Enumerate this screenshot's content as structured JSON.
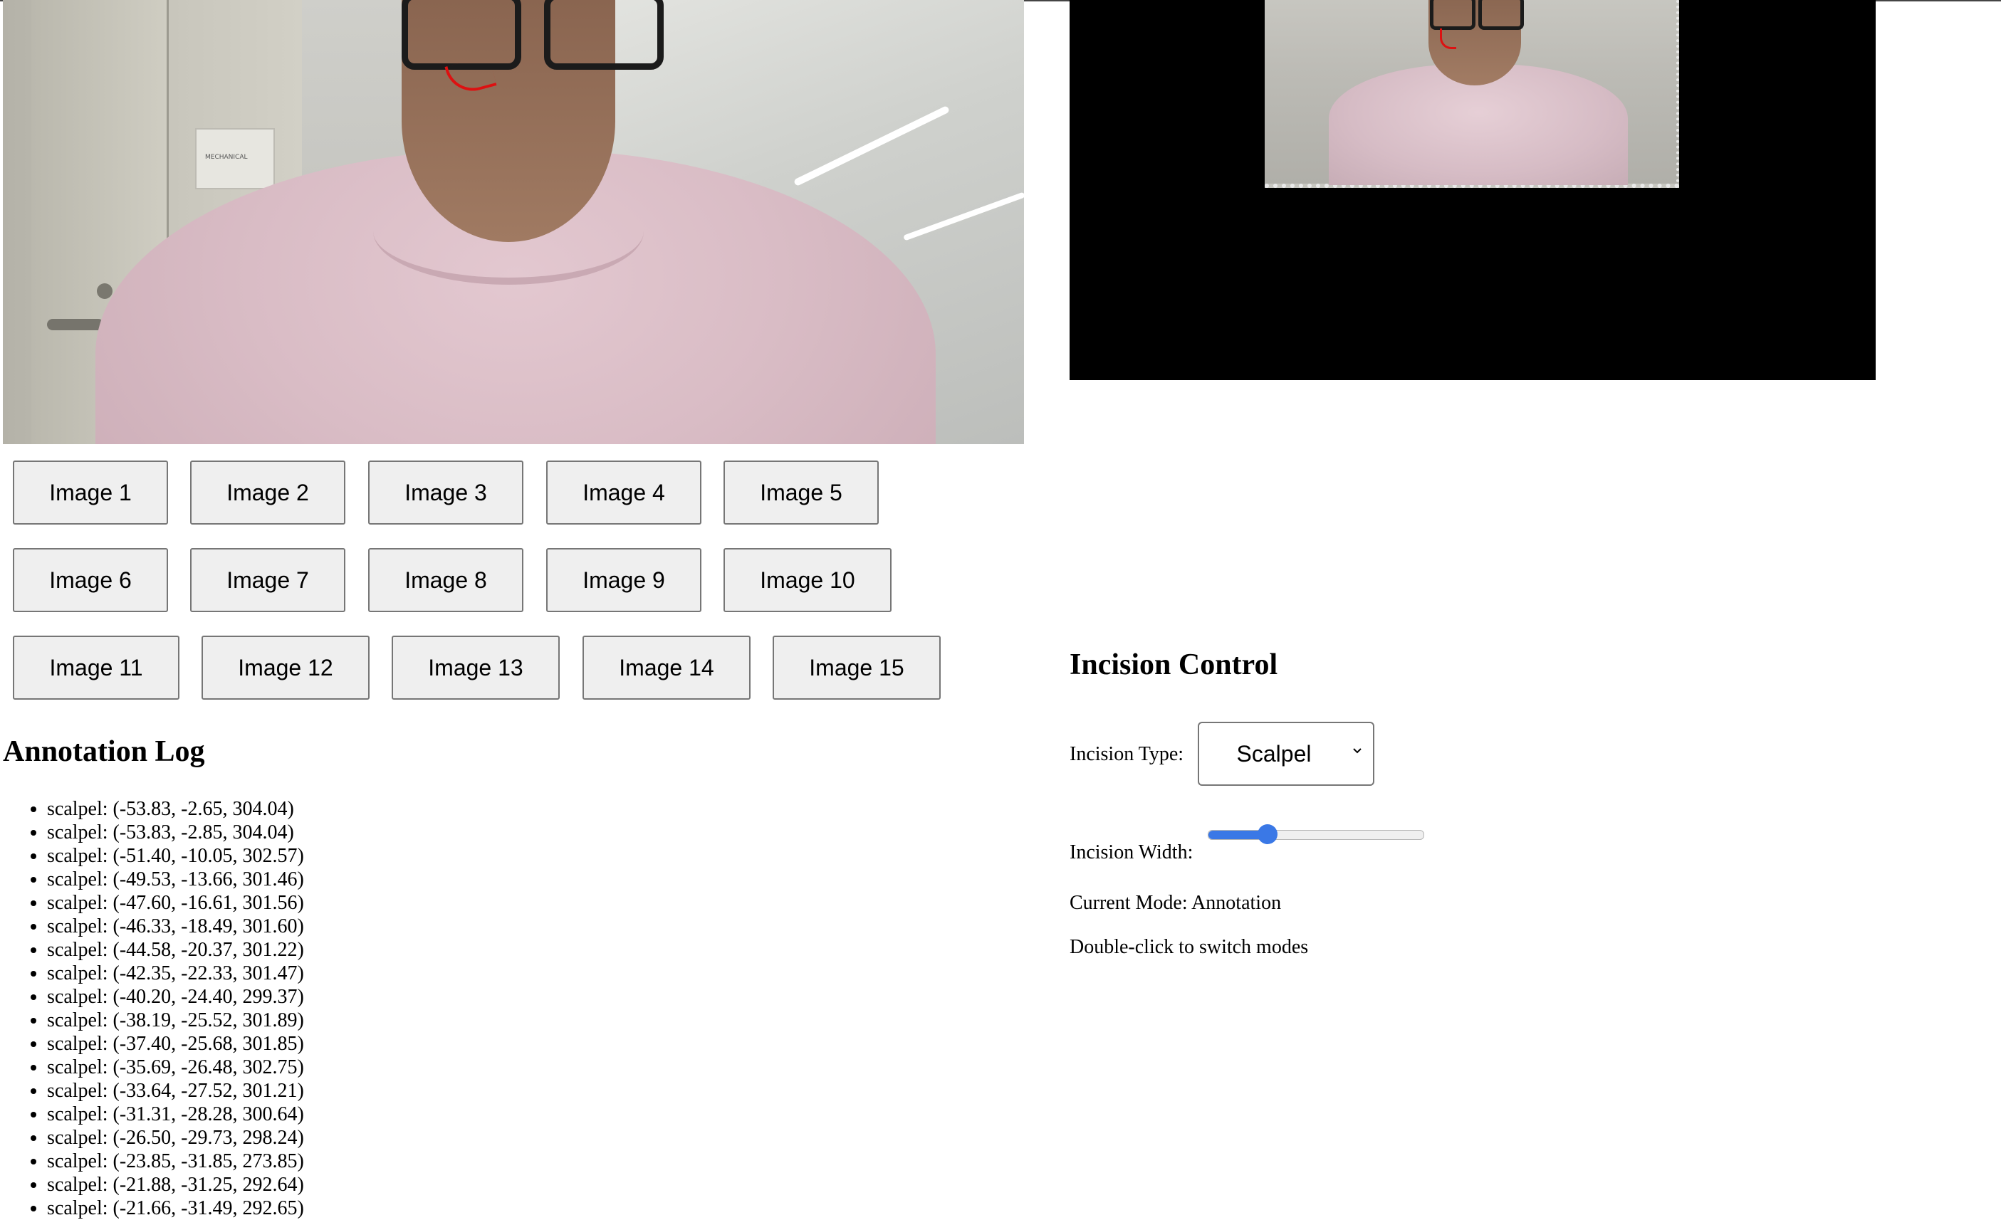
{
  "images": {
    "row1": [
      "Image 1",
      "Image 2",
      "Image 3",
      "Image 4",
      "Image 5"
    ],
    "row2": [
      "Image 6",
      "Image 7",
      "Image 8",
      "Image 9",
      "Image 10"
    ],
    "row3": [
      "Image 11",
      "Image 12",
      "Image 13",
      "Image 14",
      "Image 15"
    ]
  },
  "camera": {
    "sign_text": "MECHANICAL"
  },
  "annotation_log": {
    "title": "Annotation Log",
    "entries": [
      "scalpel: (-53.83, -2.65, 304.04)",
      "scalpel: (-53.83, -2.85, 304.04)",
      "scalpel: (-51.40, -10.05, 302.57)",
      "scalpel: (-49.53, -13.66, 301.46)",
      "scalpel: (-47.60, -16.61, 301.56)",
      "scalpel: (-46.33, -18.49, 301.60)",
      "scalpel: (-44.58, -20.37, 301.22)",
      "scalpel: (-42.35, -22.33, 301.47)",
      "scalpel: (-40.20, -24.40, 299.37)",
      "scalpel: (-38.19, -25.52, 301.89)",
      "scalpel: (-37.40, -25.68, 301.85)",
      "scalpel: (-35.69, -26.48, 302.75)",
      "scalpel: (-33.64, -27.52, 301.21)",
      "scalpel: (-31.31, -28.28, 300.64)",
      "scalpel: (-26.50, -29.73, 298.24)",
      "scalpel: (-23.85, -31.85, 273.85)",
      "scalpel: (-21.88, -31.25, 292.64)",
      "scalpel: (-21.66, -31.49, 292.65)"
    ]
  },
  "incision_control": {
    "title": "Incision Control",
    "type_label": "Incision Type:",
    "type_value": "Scalpel",
    "width_label": "Incision Width:",
    "width_fraction": 0.25,
    "current_mode": "Current Mode: Annotation",
    "hint": "Double-click to switch modes"
  },
  "colors": {
    "slider_accent": "#3a78e6",
    "annotation_stroke": "#dd1111",
    "render_background": "#000000"
  }
}
